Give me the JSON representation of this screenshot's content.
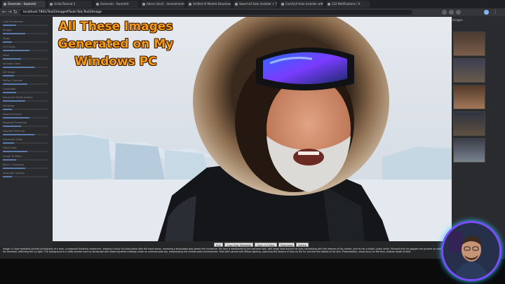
{
  "browser": {
    "tabs": [
      {
        "label": "Generate - SwarmUI",
        "active": true
      },
      {
        "label": "Grids/Tutorial 2",
        "active": false
      },
      {
        "label": "Generate - SwarmUI",
        "active": false
      },
      {
        "label": "Adora (ILLU) - Imoelementm...",
        "active": false
      },
      {
        "label": "Unified AI Models Downloader",
        "active": false
      },
      {
        "label": "SwarmUI Auto Installer + The...",
        "active": false
      },
      {
        "label": "ComfyUI Auto Installer with Fl...",
        "active": false
      },
      {
        "label": "232 Notifications / X",
        "active": false
      }
    ],
    "url": "localhost:7801/Text2Image#Tools-Tab;Text2Image"
  },
  "sidebar": {
    "rows": [
      "Core Parameters",
      "Images",
      "Steps",
      "CFG Scale",
      "Seed",
      "Variation Seed",
      "Init Image",
      "Refine / Upscale",
      "ControlNet",
      "Advanced Model Addons",
      "Sampling",
      "Swarm Internal",
      "Regional Prompting",
      "Segment Refining",
      "Advanced Video",
      "Other Fixes",
      "Image To Video",
      "Batch / Compose",
      "Alternate Options"
    ]
  },
  "gallery": {
    "label": "Images"
  },
  "image": {
    "overlay_text": [
      "All These Images",
      "Generated on My",
      "Windows PC"
    ]
  },
  "toolbar": {
    "buttons": [
      "Star",
      "Copy Raw Metadata",
      "Open In Folder",
      "Download",
      "Delete"
    ]
  },
  "prompt_text": "Image: A close headshot portrait photograph of a man, a seasoned Antarctic researcher, wearing a bulky fur-lined parka with the hood drawn, revealing a windswept gray beard and mustache. His face is weathered by the extreme cold, with laugh lines around his eyes contrasting with the redness of his cheeks, and he has a bright, joyful smile. Mirrored blue ski goggles are pushed up onto his forehead, reflecting the icy light. The background is a softly blurred vast icy landscape with towering white icebergs under an overcast pale sky, emphasizing the remote polar environment. Shot with natural soft diffuse lighting, capturing the texture of frost on the fur and the fine details of his skin. Photorealistic, sharp focus on the face, shallow depth of field."
}
